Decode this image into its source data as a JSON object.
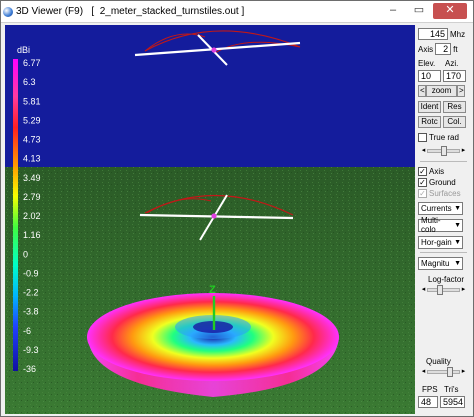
{
  "window": {
    "title": "3D Viewer (F9)   [  2_meter_stacked_turnstiles.out ]",
    "minimize": "–",
    "maximize": "▭",
    "close": "✕"
  },
  "scale": {
    "unit": "dBi",
    "labels": [
      "6.77",
      "6.3",
      "5.81",
      "5.29",
      "4.73",
      "4.13",
      "3.49",
      "2.79",
      "2.02",
      "1.16",
      "0",
      "-0.9",
      "-2.2",
      "-3.8",
      "-6",
      "-9.3",
      "-36"
    ]
  },
  "axis_label": "Z",
  "panel": {
    "frequency": {
      "value": "145",
      "unit": "Mhz"
    },
    "axis": {
      "label": "Axis",
      "value": "2",
      "unit": "ft"
    },
    "elev_label": "Elev.",
    "azi_label": "Azi.",
    "elev_value": "10",
    "azi_value": "170",
    "zoom": {
      "left": "<",
      "label": "zoom",
      "right": ">"
    },
    "buttons": {
      "ident": "Ident",
      "res": "Res",
      "rotc": "Rotc",
      "col": "Col."
    },
    "true_rad": {
      "label": "True rad",
      "checked": false
    },
    "checkboxes": {
      "axis": {
        "label": "Axis",
        "checked": true
      },
      "ground": {
        "label": "Ground",
        "checked": true
      },
      "surfaces": {
        "label": "Surfaces",
        "checked": true,
        "disabled": true
      }
    },
    "selects": {
      "currents": "Currents",
      "multi_color": "Multi-colo",
      "hor_gain": "Hor-gain",
      "magnitude": "Magnitu"
    },
    "log_factor_label": "Log-factor",
    "quality_label": "Quality",
    "fps_label": "FPS",
    "tris_label": "Tri's",
    "fps_value": "48",
    "tris_value": "5954"
  },
  "colors": {
    "sky": "#141c9c",
    "ground": "#2f6a2a",
    "antenna_element": "#ffffff",
    "current_line": "#c01818",
    "feed": "#e040e0",
    "z_axis": "#22cc22"
  }
}
